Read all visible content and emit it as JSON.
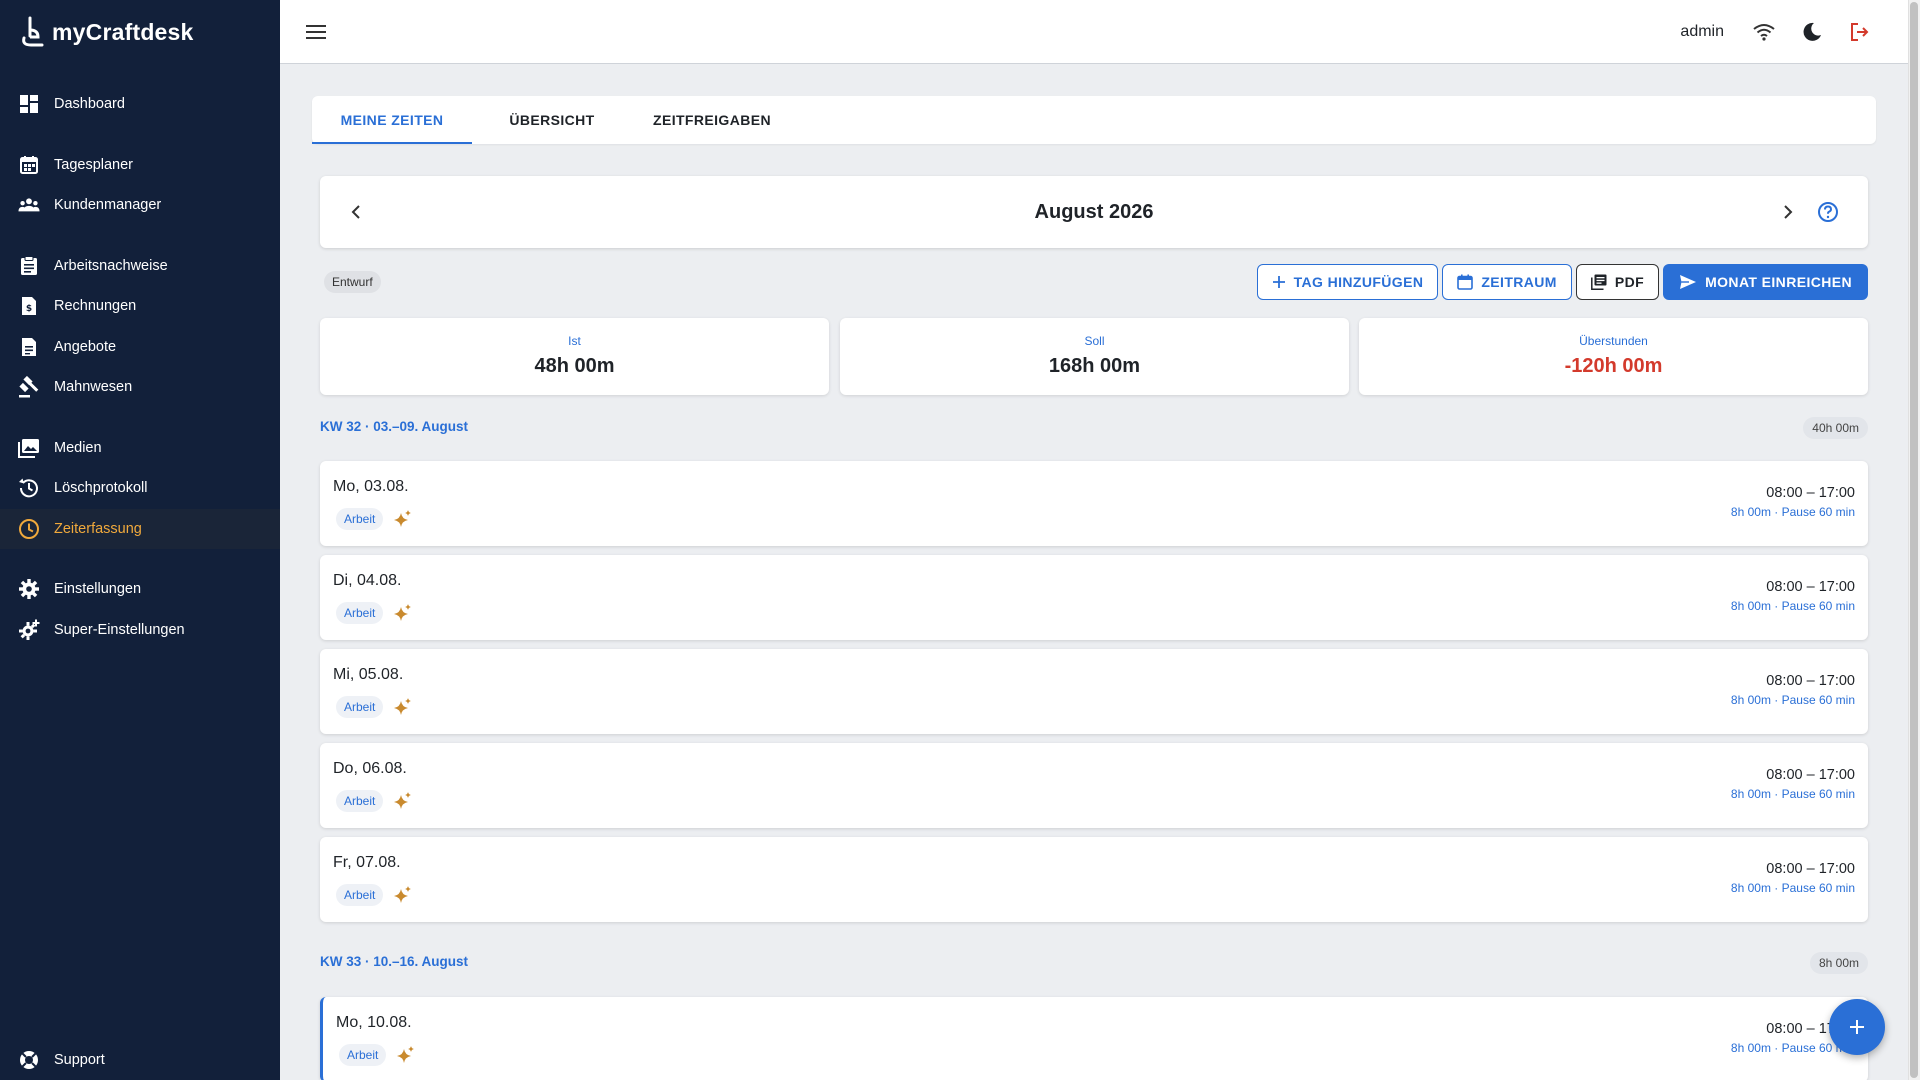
{
  "app": {
    "name": "myCraftdesk"
  },
  "sidebar": {
    "items": [
      {
        "label": "Dashboard",
        "icon": "dashboard-icon"
      },
      {
        "label": "Tagesplaner",
        "icon": "calendar-icon"
      },
      {
        "label": "Kundenmanager",
        "icon": "people-icon"
      },
      {
        "label": "Arbeitsnachweise",
        "icon": "clipboard-icon"
      },
      {
        "label": "Rechnungen",
        "icon": "invoice-icon"
      },
      {
        "label": "Angebote",
        "icon": "document-icon"
      },
      {
        "label": "Mahnwesen",
        "icon": "gavel-icon"
      },
      {
        "label": "Medien",
        "icon": "photo-library-icon"
      },
      {
        "label": "Löschprotokoll",
        "icon": "history-icon"
      },
      {
        "label": "Zeiterfassung",
        "icon": "clock-icon",
        "active": true
      },
      {
        "label": "Einstellungen",
        "icon": "gear-icon"
      },
      {
        "label": "Super-Einstellungen",
        "icon": "gear-plus-icon"
      }
    ],
    "support": {
      "label": "Support",
      "icon": "lifebuoy-icon"
    }
  },
  "header": {
    "user": "admin"
  },
  "tabs": [
    {
      "label": "MEINE ZEITEN",
      "active": true
    },
    {
      "label": "ÜBERSICHT"
    },
    {
      "label": "ZEITFREIGABEN"
    }
  ],
  "month": {
    "title": "August 2026"
  },
  "status": {
    "label": "Entwurf"
  },
  "actions": {
    "add_day": "TAG HINZUFÜGEN",
    "range": "ZEITRAUM",
    "pdf": "PDF",
    "submit": "MONAT EINREICHEN"
  },
  "stats": [
    {
      "label": "Ist",
      "value": "48h 00m"
    },
    {
      "label": "Soll",
      "value": "168h 00m"
    },
    {
      "label": "Überstunden",
      "value": "-120h 00m",
      "negative": true
    }
  ],
  "weeks": [
    {
      "label": "KW 32 · 03.–09. August",
      "total": "40h 00m",
      "days": [
        {
          "date": "Mo, 03.08.",
          "type": "Arbeit",
          "range": "08:00 – 17:00",
          "detail": "8h 00m · Pause 60 min"
        },
        {
          "date": "Di, 04.08.",
          "type": "Arbeit",
          "range": "08:00 – 17:00",
          "detail": "8h 00m · Pause 60 min"
        },
        {
          "date": "Mi, 05.08.",
          "type": "Arbeit",
          "range": "08:00 – 17:00",
          "detail": "8h 00m · Pause 60 min"
        },
        {
          "date": "Do, 06.08.",
          "type": "Arbeit",
          "range": "08:00 – 17:00",
          "detail": "8h 00m · Pause 60 min"
        },
        {
          "date": "Fr, 07.08.",
          "type": "Arbeit",
          "range": "08:00 – 17:00",
          "detail": "8h 00m · Pause 60 min"
        }
      ]
    },
    {
      "label": "KW 33 · 10.–16. August",
      "total": "8h 00m",
      "days": [
        {
          "date": "Mo, 10.08.",
          "type": "Arbeit",
          "range": "08:00 – 17:00",
          "detail": "8h 00m · Pause 60 min"
        }
      ]
    }
  ],
  "colors": {
    "sidebar_bg": "#12203a",
    "accent": "#2a6fd6",
    "active_nav": "#f0a93c",
    "negative": "#d33a2c",
    "sparkle": "#c98a2e",
    "logout": "#d33a2c"
  }
}
